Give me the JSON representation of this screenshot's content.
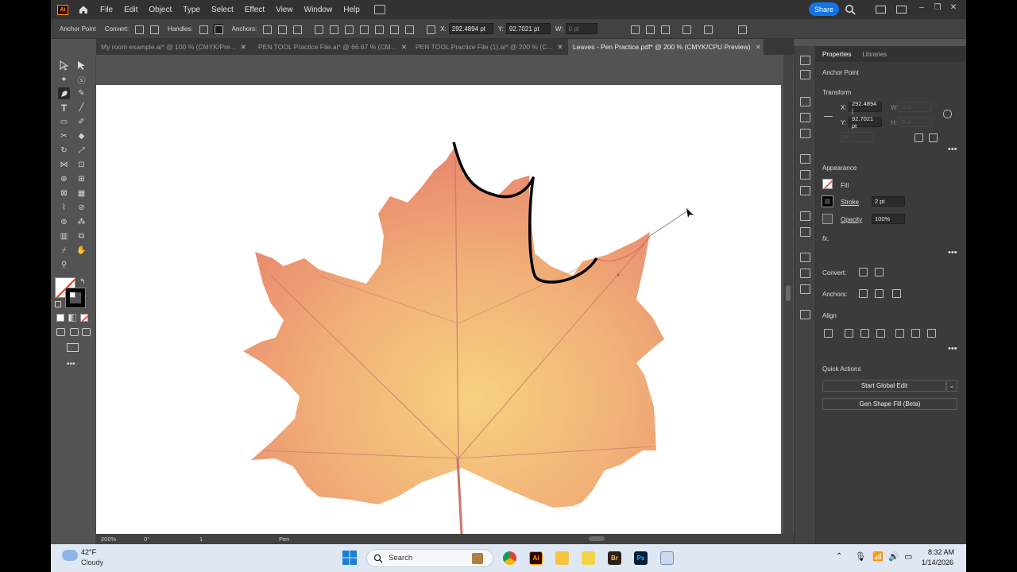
{
  "menubar": {
    "logo": "Ai",
    "items": [
      "File",
      "Edit",
      "Object",
      "Type",
      "Select",
      "Effect",
      "View",
      "Window",
      "Help"
    ],
    "share_label": "Share",
    "window_controls": [
      "–",
      "❐",
      "✕"
    ]
  },
  "controlbar": {
    "selection_label": "Anchor Point",
    "convert_label": "Convert:",
    "handles_label": "Handles:",
    "anchors_label": "Anchors:",
    "x_label": "X:",
    "x_value": "292.4894 pt",
    "y_label": "Y:",
    "y_value": "92.7021 pt",
    "w_label": "W:",
    "w_value": "0 pt"
  },
  "tabs": [
    {
      "label": "My room example.ai* @ 100 % (CMYK/Pre...",
      "close": "✕"
    },
    {
      "label": "PEN TOOL Practice File.ai* @ 66.67 % (CM...",
      "close": "✕"
    },
    {
      "label": "PEN TOOL Practice File (1).ai* @ 200 % (C...",
      "close": "✕"
    },
    {
      "label": "Leaves - Pen Practice.pdf* @ 200 % (CMYK/CPU Preview)",
      "close": "✕"
    }
  ],
  "statusbar": {
    "zoom": "200%",
    "rotation": "0°",
    "artboard": "1",
    "current_tool": "Pen"
  },
  "panel": {
    "tabs": [
      "Properties",
      "Libraries"
    ],
    "selection_type": "Anchor Point",
    "transform": {
      "heading": "Transform",
      "x_label": "X:",
      "x_value": "292.4894 |",
      "y_label": "Y:",
      "y_value": "92.7021 pt",
      "w_label": "W:",
      "w_value": "0 pt",
      "h_label": "H:",
      "h_value": "0 pt",
      "angle_value": "0°"
    },
    "appearance": {
      "heading": "Appearance",
      "fill_label": "Fill",
      "stroke_label": "Stroke",
      "stroke_weight": "2 pt",
      "opacity_label": "Opacity",
      "opacity_value": "100%",
      "fx_label": "fx."
    },
    "convert_label": "Convert:",
    "anchors_label": "Anchors:",
    "align_heading": "Align",
    "quick_actions": {
      "heading": "Quick Actions",
      "start_global_edit": "Start Global Edit",
      "gen_shape_fill": "Gen Shape Fill (Beta)"
    },
    "more": "•••"
  },
  "taskbar": {
    "weather_temp": "42°F",
    "weather_desc": "Cloudy",
    "search_placeholder": "Search",
    "app_labels": {
      "bridge": "Br",
      "photoshop": "Ps",
      "illustrator": "Ai"
    },
    "time": "8:32 AM",
    "date": "1/14/2026"
  },
  "colors": {
    "accent": "#1473e6",
    "ai_orange": "#ff9a00",
    "ui_dark": "#323232",
    "ui_mid": "#535353",
    "leaf_orange": "#eb9a5e",
    "path_stroke": "#000000"
  }
}
